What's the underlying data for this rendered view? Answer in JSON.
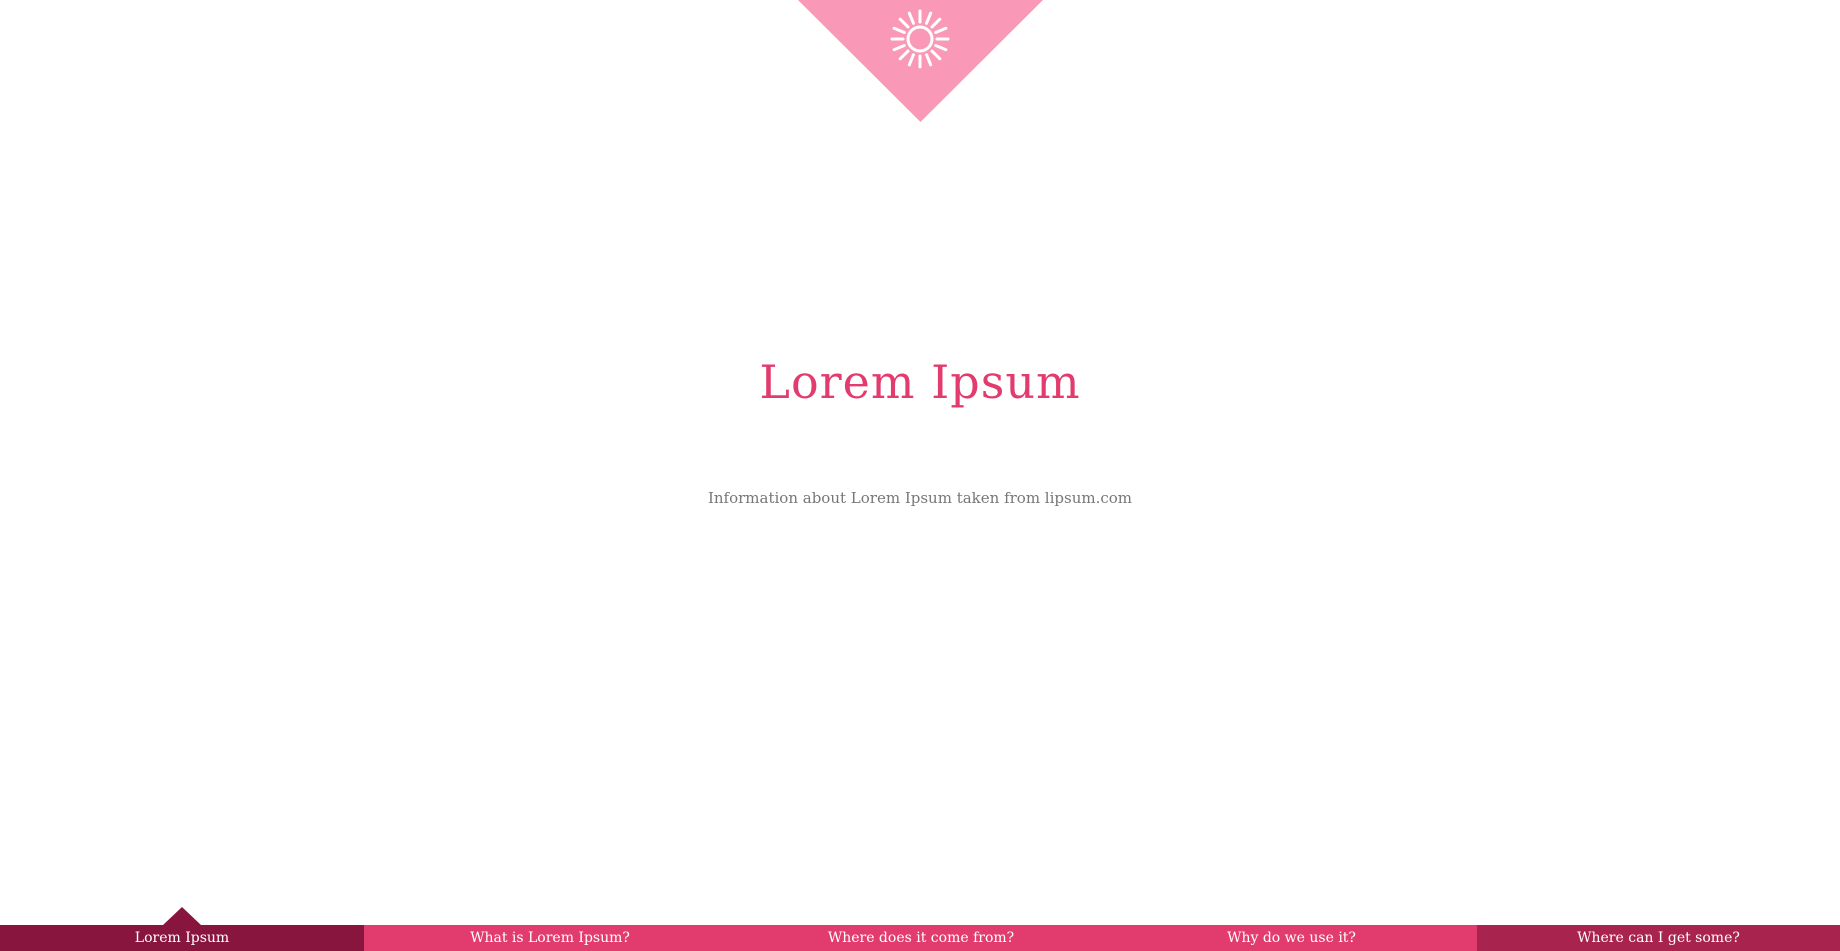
{
  "colors": {
    "badge": "#f999b7",
    "title": "#e23c6e",
    "subtitle": "#777777",
    "nav_active": "#87153d",
    "nav_default": "#e23c6e",
    "nav_last": "#a8244f"
  },
  "header": {
    "icon": "sun-icon"
  },
  "hero": {
    "title": "Lorem Ipsum",
    "subtitle": "Information about Lorem Ipsum taken from lipsum.com"
  },
  "nav": {
    "items": [
      {
        "label": "Lorem Ipsum",
        "active": true
      },
      {
        "label": "What is Lorem Ipsum?",
        "active": false
      },
      {
        "label": "Where does it come from?",
        "active": false
      },
      {
        "label": "Why do we use it?",
        "active": false
      },
      {
        "label": "Where can I get some?",
        "active": false
      }
    ]
  }
}
